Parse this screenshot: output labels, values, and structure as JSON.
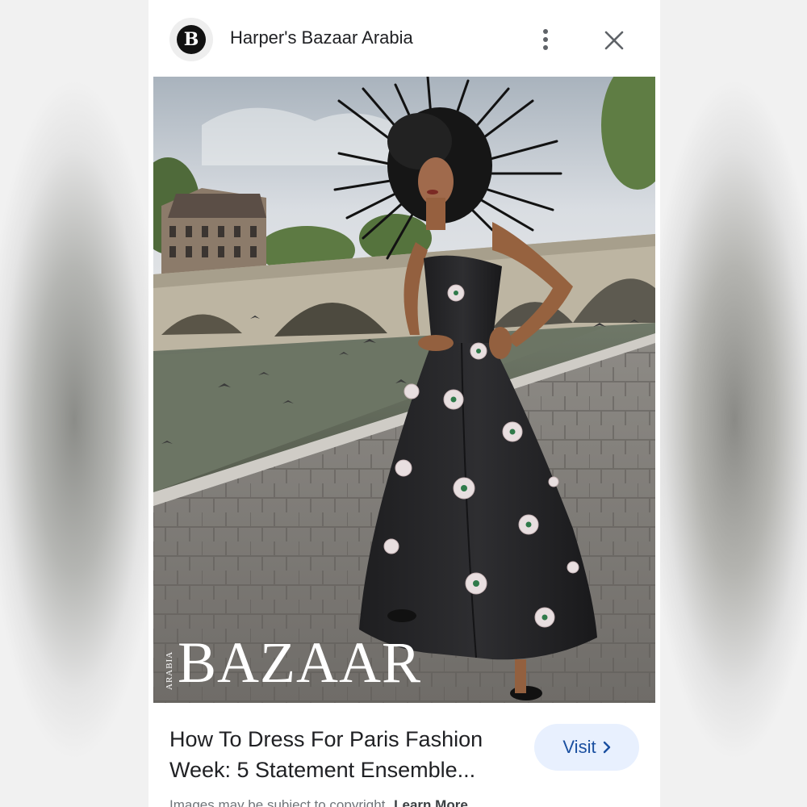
{
  "header": {
    "logo_letter": "B",
    "site_name": "Harper's Bazaar Arabia",
    "more_icon": "more-vert-icon",
    "close_icon": "close-icon"
  },
  "image": {
    "watermark_main": "BAZAAR",
    "watermark_sub": "ARABIA"
  },
  "result": {
    "title": "How To Dress For Paris Fashion Week: 5 Statement Ensemble...",
    "visit_label": "Visit",
    "visit_icon": "chevron-right-icon",
    "copyright_text": "Images may be subject to copyright.",
    "learn_more_label": "Learn More"
  },
  "colors": {
    "visit_bg": "#e8f0fe",
    "visit_text": "#1a4fa0",
    "title_text": "#202124"
  }
}
